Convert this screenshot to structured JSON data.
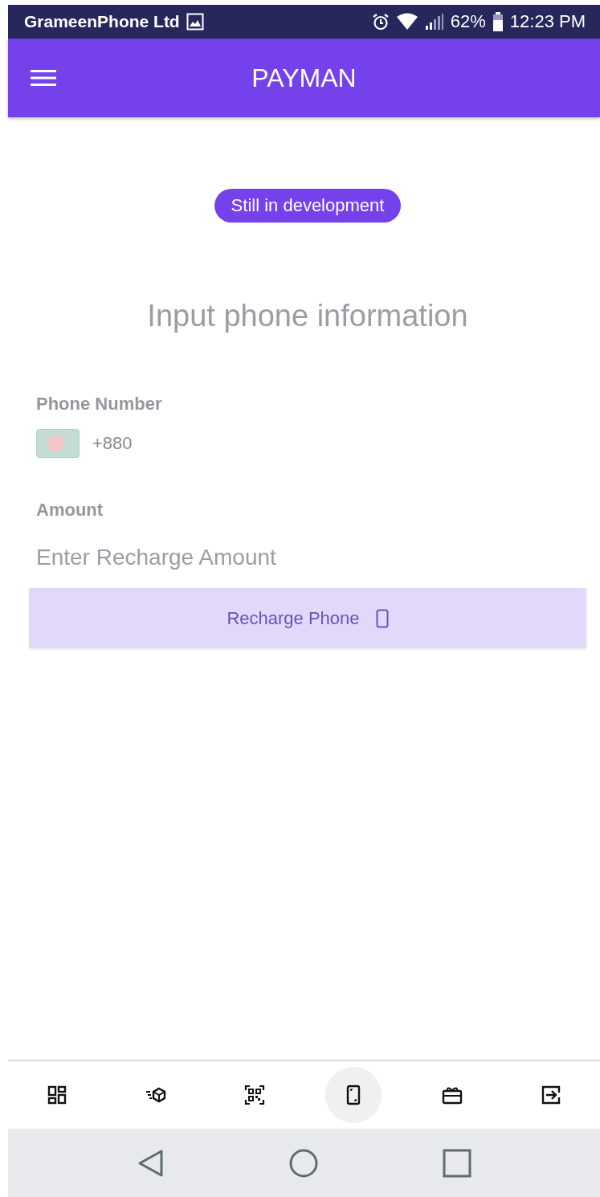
{
  "status_bar": {
    "carrier": "GrameenPhone Ltd",
    "battery": "62%",
    "time": "12:23 PM"
  },
  "app_bar": {
    "title": "PAYMAN"
  },
  "badge": "Still in development",
  "heading": "Input phone information",
  "phone_field": {
    "label": "Phone Number",
    "value": "+880"
  },
  "amount_field": {
    "label": "Amount",
    "placeholder": "Enter Recharge Amount"
  },
  "recharge_button": {
    "label": "Recharge Phone",
    "disabled": true
  },
  "bottom_nav": [
    {
      "kind": "dashboard",
      "selected": false
    },
    {
      "kind": "delivery",
      "selected": false
    },
    {
      "kind": "qr",
      "selected": false
    },
    {
      "kind": "phone",
      "selected": true
    },
    {
      "kind": "gift",
      "selected": false
    },
    {
      "kind": "logout",
      "selected": false
    }
  ]
}
